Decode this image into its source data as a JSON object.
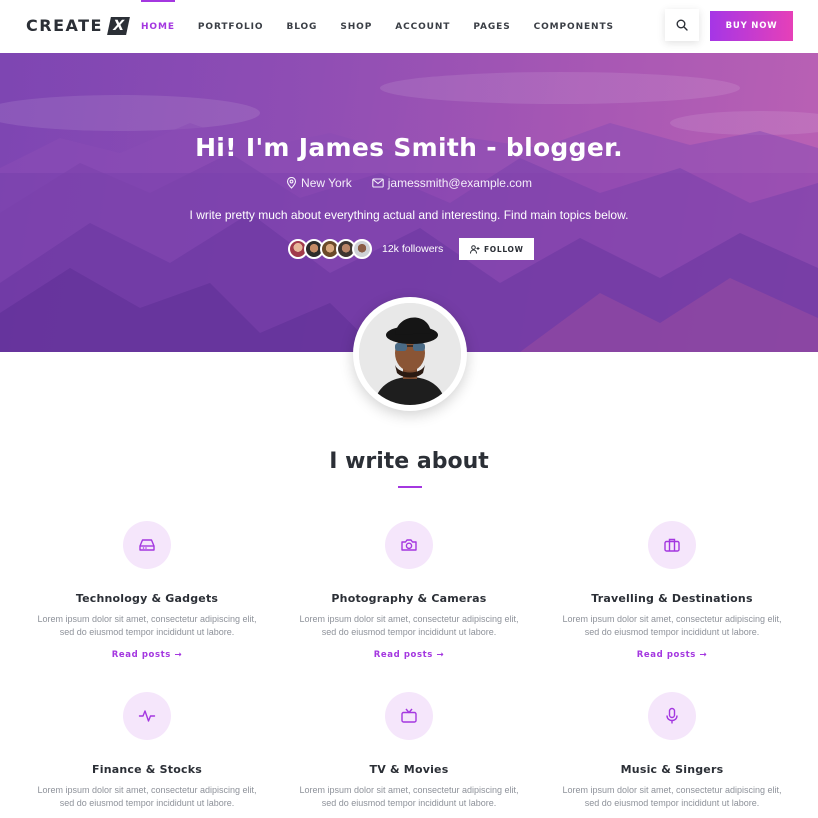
{
  "nav": {
    "logo_text": "CREATE",
    "logo_mark": "X",
    "items": [
      "HOME",
      "PORTFOLIO",
      "BLOG",
      "SHOP",
      "ACCOUNT",
      "PAGES",
      "COMPONENTS"
    ],
    "active_item": "HOME",
    "search_icon": "search-icon",
    "buy_label": "BUY NOW"
  },
  "hero": {
    "title": "Hi! I'm James Smith - blogger.",
    "location": "New York",
    "email": "jamessmith@example.com",
    "description": "I write pretty much about everything actual and interesting. Find main topics below.",
    "followers": "12k followers",
    "follow_label": "FOLLOW"
  },
  "about": {
    "title": "I write about",
    "topics": [
      {
        "title": "Technology & Gadgets",
        "text_line1": "Lorem ipsum dolor sit amet, consectetur adipiscing elit,",
        "text_line2": "sed do eiusmod tempor incididunt ut labore.",
        "link": "Read posts →",
        "icon": "hard-drive-icon"
      },
      {
        "title": "Photography & Cameras",
        "text_line1": "Lorem ipsum dolor sit amet, consectetur adipiscing elit,",
        "text_line2": "sed do eiusmod tempor incididunt ut labore.",
        "link": "Read posts →",
        "icon": "camera-icon"
      },
      {
        "title": "Travelling & Destinations",
        "text_line1": "Lorem ipsum dolor sit amet, consectetur adipiscing elit,",
        "text_line2": "sed do eiusmod tempor incididunt ut labore.",
        "link": "Read posts →",
        "icon": "briefcase-icon"
      },
      {
        "title": "Finance & Stocks",
        "text_line1": "Lorem ipsum dolor sit amet, consectetur adipiscing elit,",
        "text_line2": "sed do eiusmod tempor incididunt ut labore.",
        "icon": "activity-icon"
      },
      {
        "title": "TV & Movies",
        "text_line1": "Lorem ipsum dolor sit amet, consectetur adipiscing elit,",
        "text_line2": "sed do eiusmod tempor incididunt ut labore.",
        "icon": "tv-icon"
      },
      {
        "title": "Music & Singers",
        "text_line1": "Lorem ipsum dolor sit amet, consectetur adipiscing elit,",
        "text_line2": "sed do eiusmod tempor incididunt ut labore.",
        "icon": "microphone-icon"
      }
    ]
  },
  "colors": {
    "accent": "#a437e0",
    "hero_start": "#6b3aa8",
    "hero_end": "#b255b0",
    "icon_bg": "#f5e6fb"
  }
}
